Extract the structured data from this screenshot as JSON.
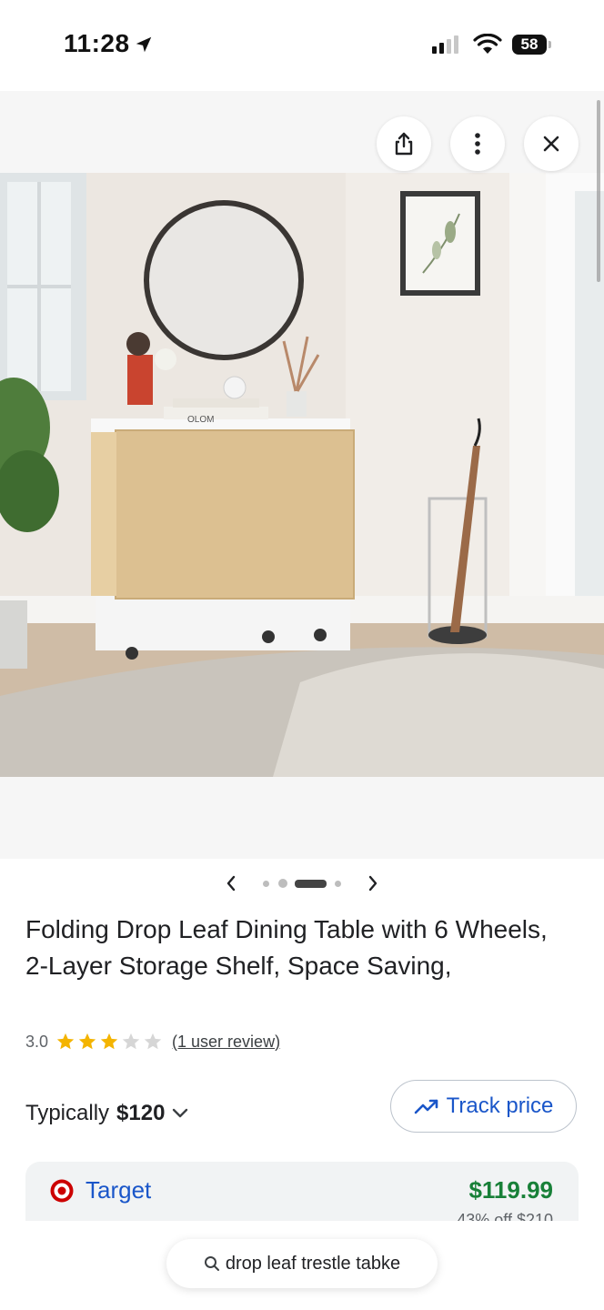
{
  "status_bar": {
    "time": "11:28",
    "battery": "58"
  },
  "carousel": {
    "dots": 4,
    "active_index": 2
  },
  "product": {
    "title": "Folding Drop Leaf Dining Table with 6 Wheels, 2-Layer Storage Shelf, Space Saving,",
    "rating": "3.0",
    "stars_filled": 3,
    "stars_total": 5,
    "reviews": "(1 user review)",
    "book_label": "OLOM"
  },
  "price": {
    "typically_label": "Typically",
    "typically_value": "$120",
    "track_label": "Track price"
  },
  "offer": {
    "store": "Target",
    "price": "$119.99",
    "discount": "43% off $210"
  },
  "search": {
    "query": "drop leaf trestle tabke"
  },
  "colors": {
    "link_blue": "#1a56c9",
    "price_green": "#188038",
    "star_gold": "#f4b400",
    "target_red": "#cc0000"
  }
}
